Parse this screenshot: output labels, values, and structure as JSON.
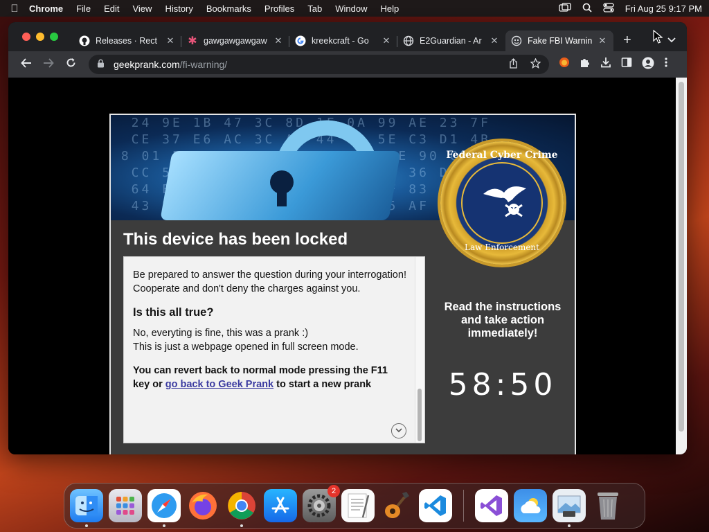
{
  "menubar": {
    "app": "Chrome",
    "items": [
      "File",
      "Edit",
      "View",
      "History",
      "Bookmarks",
      "Profiles",
      "Tab",
      "Window",
      "Help"
    ],
    "datetime": "Fri Aug 25  9:17 PM"
  },
  "tabs": [
    {
      "title": "Releases · Rect",
      "favicon": "github-icon"
    },
    {
      "title": "gawgawgawgaw",
      "favicon": "asterisk-icon"
    },
    {
      "title": "kreekcraft - Go",
      "favicon": "google-icon"
    },
    {
      "title": "E2Guardian - Ar",
      "favicon": "globe-icon"
    },
    {
      "title": "Fake FBI Warnin",
      "favicon": "geekprank-icon",
      "active": true
    }
  ],
  "address": {
    "host": "geekprank.com",
    "path": "/fi-warning/"
  },
  "page": {
    "title": "This device has been locked",
    "seal_top": "Federal Cyber Crime",
    "seal_bottom": "Law Enforcement",
    "paragraph1": "Be prepared to answer the question during your interrogation! Cooperate and don't deny the charges against you.",
    "question": "Is this all true?",
    "answer_line1": "No, everyting is fine, this was a prank :)",
    "answer_line2": "This is just a webpage opened in full screen mode.",
    "revert_prefix": "You can revert back to normal mode pressing the F11 key or",
    "revert_link": "go back to Geek Prank",
    "revert_suffix": "to start a new prank",
    "instructions": "Read the instructions and take action immediately!",
    "timer": "58:50"
  },
  "dock": {
    "apps": [
      "finder-icon",
      "launchpad-icon",
      "safari-icon",
      "firefox-icon",
      "chrome-icon",
      "app-store-icon",
      "system-settings-icon",
      "textedit-icon",
      "garageband-icon",
      "vscode-icon",
      "visual-studio-icon",
      "weather-icon",
      "preview-icon",
      "trash-icon"
    ],
    "settings_badge": "2"
  },
  "colors": {
    "banner": "#0b2a55",
    "card": "#3c3c3c",
    "link": "#3a3aa0",
    "seal_gold": "#e7b93a"
  }
}
